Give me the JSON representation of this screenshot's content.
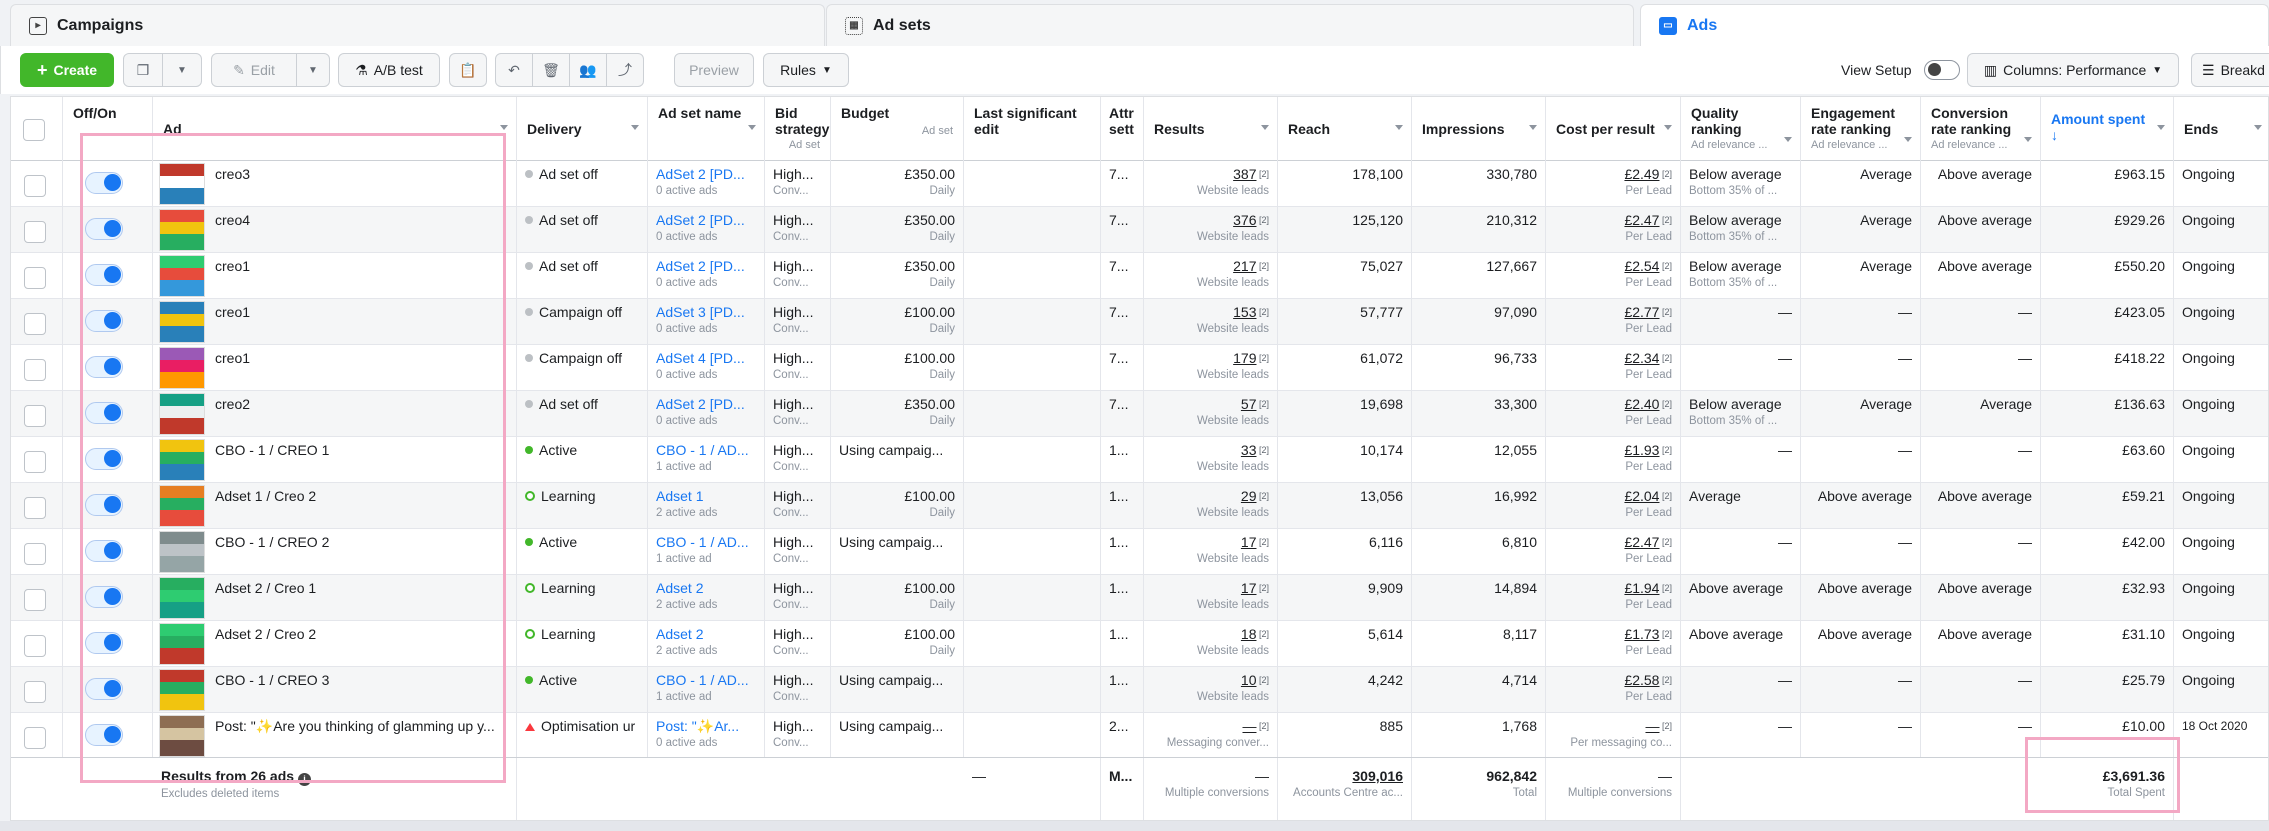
{
  "tabs": [
    {
      "label": "Campaigns",
      "icon": "folder-icon"
    },
    {
      "label": "Ad sets",
      "icon": "grid-icon"
    },
    {
      "label": "Ads",
      "icon": "ads-icon"
    }
  ],
  "toolbar": {
    "create_label": "Create",
    "edit_label": "Edit",
    "ab_test_label": "A/B test",
    "preview_label": "Preview",
    "rules_label": "Rules",
    "view_setup_label": "View Setup",
    "columns_label": "Columns: Performance",
    "breakdown_label": "Breakd"
  },
  "columns": [
    {
      "key": "off_on",
      "label": "Off/On",
      "sub": ""
    },
    {
      "key": "ad",
      "label": "Ad",
      "sub": ""
    },
    {
      "key": "delivery",
      "label": "Delivery",
      "sub": ""
    },
    {
      "key": "adset",
      "label": "Ad set name",
      "sub": ""
    },
    {
      "key": "bid",
      "label": "Bid strategy",
      "sub": "Ad set"
    },
    {
      "key": "budget",
      "label": "Budget",
      "sub": "Ad set"
    },
    {
      "key": "last_edit",
      "label": "Last significant edit",
      "sub": ""
    },
    {
      "key": "attr",
      "label": "Attr sett",
      "sub": ""
    },
    {
      "key": "results",
      "label": "Results",
      "sub": ""
    },
    {
      "key": "reach",
      "label": "Reach",
      "sub": ""
    },
    {
      "key": "impressions",
      "label": "Impressions",
      "sub": ""
    },
    {
      "key": "cpr",
      "label": "Cost per result",
      "sub": ""
    },
    {
      "key": "quality",
      "label": "Quality ranking",
      "sub": "Ad relevance ..."
    },
    {
      "key": "engagement",
      "label": "Engagement rate ranking",
      "sub": "Ad relevance ..."
    },
    {
      "key": "conversion",
      "label": "Conversion rate ranking",
      "sub": "Ad relevance ..."
    },
    {
      "key": "spent",
      "label": "Amount spent",
      "sub": "↓"
    },
    {
      "key": "ends",
      "label": "Ends",
      "sub": ""
    }
  ],
  "rows": [
    {
      "ad": "creo3",
      "delivery": "Ad set off",
      "dstate": "off",
      "adset": "AdSet 2 [PD...",
      "adset_sub": "0 active ads",
      "bid": "High...",
      "bid_sub": "Conv...",
      "budget": "£350.00",
      "budget_sub": "Daily",
      "attr": "7...",
      "results": "387",
      "results_sub": "Website leads",
      "reach": "178,100",
      "impressions": "330,780",
      "cpr": "£2.49",
      "cpr_sub": "Per Lead",
      "quality": "Below average",
      "quality_sub": "Bottom 35% of ...",
      "engagement": "Average",
      "conversion": "Above average",
      "spent": "£963.15",
      "ends": "Ongoing"
    },
    {
      "ad": "creo4",
      "delivery": "Ad set off",
      "dstate": "off",
      "adset": "AdSet 2 [PD...",
      "adset_sub": "0 active ads",
      "bid": "High...",
      "bid_sub": "Conv...",
      "budget": "£350.00",
      "budget_sub": "Daily",
      "attr": "7...",
      "results": "376",
      "results_sub": "Website leads",
      "reach": "125,120",
      "impressions": "210,312",
      "cpr": "£2.47",
      "cpr_sub": "Per Lead",
      "quality": "Below average",
      "quality_sub": "Bottom 35% of ...",
      "engagement": "Average",
      "conversion": "Above average",
      "spent": "£929.26",
      "ends": "Ongoing"
    },
    {
      "ad": "creo1",
      "delivery": "Ad set off",
      "dstate": "off",
      "adset": "AdSet 2 [PD...",
      "adset_sub": "0 active ads",
      "bid": "High...",
      "bid_sub": "Conv...",
      "budget": "£350.00",
      "budget_sub": "Daily",
      "attr": "7...",
      "results": "217",
      "results_sub": "Website leads",
      "reach": "75,027",
      "impressions": "127,667",
      "cpr": "£2.54",
      "cpr_sub": "Per Lead",
      "quality": "Below average",
      "quality_sub": "Bottom 35% of ...",
      "engagement": "Average",
      "conversion": "Above average",
      "spent": "£550.20",
      "ends": "Ongoing"
    },
    {
      "ad": "creo1",
      "delivery": "Campaign off",
      "dstate": "off",
      "adset": "AdSet 3 [PD...",
      "adset_sub": "0 active ads",
      "bid": "High...",
      "bid_sub": "Conv...",
      "budget": "£100.00",
      "budget_sub": "Daily",
      "attr": "7...",
      "results": "153",
      "results_sub": "Website leads",
      "reach": "57,777",
      "impressions": "97,090",
      "cpr": "£2.77",
      "cpr_sub": "Per Lead",
      "quality": "—",
      "quality_sub": "",
      "engagement": "—",
      "conversion": "—",
      "spent": "£423.05",
      "ends": "Ongoing"
    },
    {
      "ad": "creo1",
      "delivery": "Campaign off",
      "dstate": "off",
      "adset": "AdSet 4 [PD...",
      "adset_sub": "0 active ads",
      "bid": "High...",
      "bid_sub": "Conv...",
      "budget": "£100.00",
      "budget_sub": "Daily",
      "attr": "7...",
      "results": "179",
      "results_sub": "Website leads",
      "reach": "61,072",
      "impressions": "96,733",
      "cpr": "£2.34",
      "cpr_sub": "Per Lead",
      "quality": "—",
      "quality_sub": "",
      "engagement": "—",
      "conversion": "—",
      "spent": "£418.22",
      "ends": "Ongoing"
    },
    {
      "ad": "creo2",
      "delivery": "Ad set off",
      "dstate": "off",
      "adset": "AdSet 2 [PD...",
      "adset_sub": "0 active ads",
      "bid": "High...",
      "bid_sub": "Conv...",
      "budget": "£350.00",
      "budget_sub": "Daily",
      "attr": "7...",
      "results": "57",
      "results_sub": "Website leads",
      "reach": "19,698",
      "impressions": "33,300",
      "cpr": "£2.40",
      "cpr_sub": "Per Lead",
      "quality": "Below average",
      "quality_sub": "Bottom 35% of ...",
      "engagement": "Average",
      "conversion": "Average",
      "spent": "£136.63",
      "ends": "Ongoing"
    },
    {
      "ad": "CBO - 1 / CREO 1",
      "delivery": "Active",
      "dstate": "active",
      "adset": "CBO - 1 / AD...",
      "adset_sub": "1 active ad",
      "bid": "High...",
      "bid_sub": "Conv...",
      "budget": "Using campaig...",
      "budget_sub": "",
      "attr": "1...",
      "results": "33",
      "results_sub": "Website leads",
      "reach": "10,174",
      "impressions": "12,055",
      "cpr": "£1.93",
      "cpr_sub": "Per Lead",
      "quality": "—",
      "quality_sub": "",
      "engagement": "—",
      "conversion": "—",
      "spent": "£63.60",
      "ends": "Ongoing"
    },
    {
      "ad": "Adset 1 / Creo 2",
      "delivery": "Learning",
      "dstate": "learning",
      "adset": "Adset 1",
      "adset_sub": "2 active ads",
      "bid": "High...",
      "bid_sub": "Conv...",
      "budget": "£100.00",
      "budget_sub": "Daily",
      "attr": "1...",
      "results": "29",
      "results_sub": "Website leads",
      "reach": "13,056",
      "impressions": "16,992",
      "cpr": "£2.04",
      "cpr_sub": "Per Lead",
      "quality": "Average",
      "quality_sub": "",
      "engagement": "Above average",
      "conversion": "Above average",
      "spent": "£59.21",
      "ends": "Ongoing"
    },
    {
      "ad": "CBO - 1 / CREO 2",
      "delivery": "Active",
      "dstate": "active",
      "adset": "CBO - 1 / AD...",
      "adset_sub": "1 active ad",
      "bid": "High...",
      "bid_sub": "Conv...",
      "budget": "Using campaig...",
      "budget_sub": "",
      "attr": "1...",
      "results": "17",
      "results_sub": "Website leads",
      "reach": "6,116",
      "impressions": "6,810",
      "cpr": "£2.47",
      "cpr_sub": "Per Lead",
      "quality": "—",
      "quality_sub": "",
      "engagement": "—",
      "conversion": "—",
      "spent": "£42.00",
      "ends": "Ongoing"
    },
    {
      "ad": "Adset 2 / Creo 1",
      "delivery": "Learning",
      "dstate": "learning",
      "adset": "Adset 2",
      "adset_sub": "2 active ads",
      "bid": "High...",
      "bid_sub": "Conv...",
      "budget": "£100.00",
      "budget_sub": "Daily",
      "attr": "1...",
      "results": "17",
      "results_sub": "Website leads",
      "reach": "9,909",
      "impressions": "14,894",
      "cpr": "£1.94",
      "cpr_sub": "Per Lead",
      "quality": "Above average",
      "quality_sub": "",
      "engagement": "Above average",
      "conversion": "Above average",
      "spent": "£32.93",
      "ends": "Ongoing"
    },
    {
      "ad": "Adset 2 / Creo 2",
      "delivery": "Learning",
      "dstate": "learning",
      "adset": "Adset 2",
      "adset_sub": "2 active ads",
      "bid": "High...",
      "bid_sub": "Conv...",
      "budget": "£100.00",
      "budget_sub": "Daily",
      "attr": "1...",
      "results": "18",
      "results_sub": "Website leads",
      "reach": "5,614",
      "impressions": "8,117",
      "cpr": "£1.73",
      "cpr_sub": "Per Lead",
      "quality": "Above average",
      "quality_sub": "",
      "engagement": "Above average",
      "conversion": "Above average",
      "spent": "£31.10",
      "ends": "Ongoing"
    },
    {
      "ad": "CBO - 1 / CREO 3",
      "delivery": "Active",
      "dstate": "active",
      "adset": "CBO - 1 / AD...",
      "adset_sub": "1 active ad",
      "bid": "High...",
      "bid_sub": "Conv...",
      "budget": "Using campaig...",
      "budget_sub": "",
      "attr": "1...",
      "results": "10",
      "results_sub": "Website leads",
      "reach": "4,242",
      "impressions": "4,714",
      "cpr": "£2.58",
      "cpr_sub": "Per Lead",
      "quality": "—",
      "quality_sub": "",
      "engagement": "—",
      "conversion": "—",
      "spent": "£25.79",
      "ends": "Ongoing"
    },
    {
      "ad": "Post: \"✨Are you thinking of glamming up y...",
      "delivery": "Optimisation ur",
      "dstate": "warn",
      "adset": "Post: \"✨Ar...",
      "adset_sub": "0 active ads",
      "bid": "High...",
      "bid_sub": "Conv...",
      "budget": "Using campaig...",
      "budget_sub": "",
      "attr": "2...",
      "results": "—",
      "results_sub": "Messaging conver...",
      "reach": "885",
      "impressions": "1,768",
      "cpr": "—",
      "cpr_sub": "Per messaging co...",
      "quality": "—",
      "quality_sub": "",
      "engagement": "—",
      "conversion": "—",
      "spent": "£10.00",
      "ends": "18 Oct 2020"
    }
  ],
  "footer": {
    "label": "Results from 26 ads",
    "sub": "Excludes deleted items",
    "last_edit": "—",
    "attr": "M...",
    "results": "—",
    "results_sub": "Multiple conversions",
    "reach": "309,016",
    "reach_sub": "Accounts Centre ac...",
    "impressions": "962,842",
    "impressions_sub": "Total",
    "cpr": "—",
    "cpr_sub": "Multiple conversions",
    "spent": "£3,691.36",
    "spent_sub": "Total Spent"
  },
  "colors": {
    "accent": "#1877f2",
    "create": "#42b72a",
    "highlight": "#f3a8c4"
  }
}
